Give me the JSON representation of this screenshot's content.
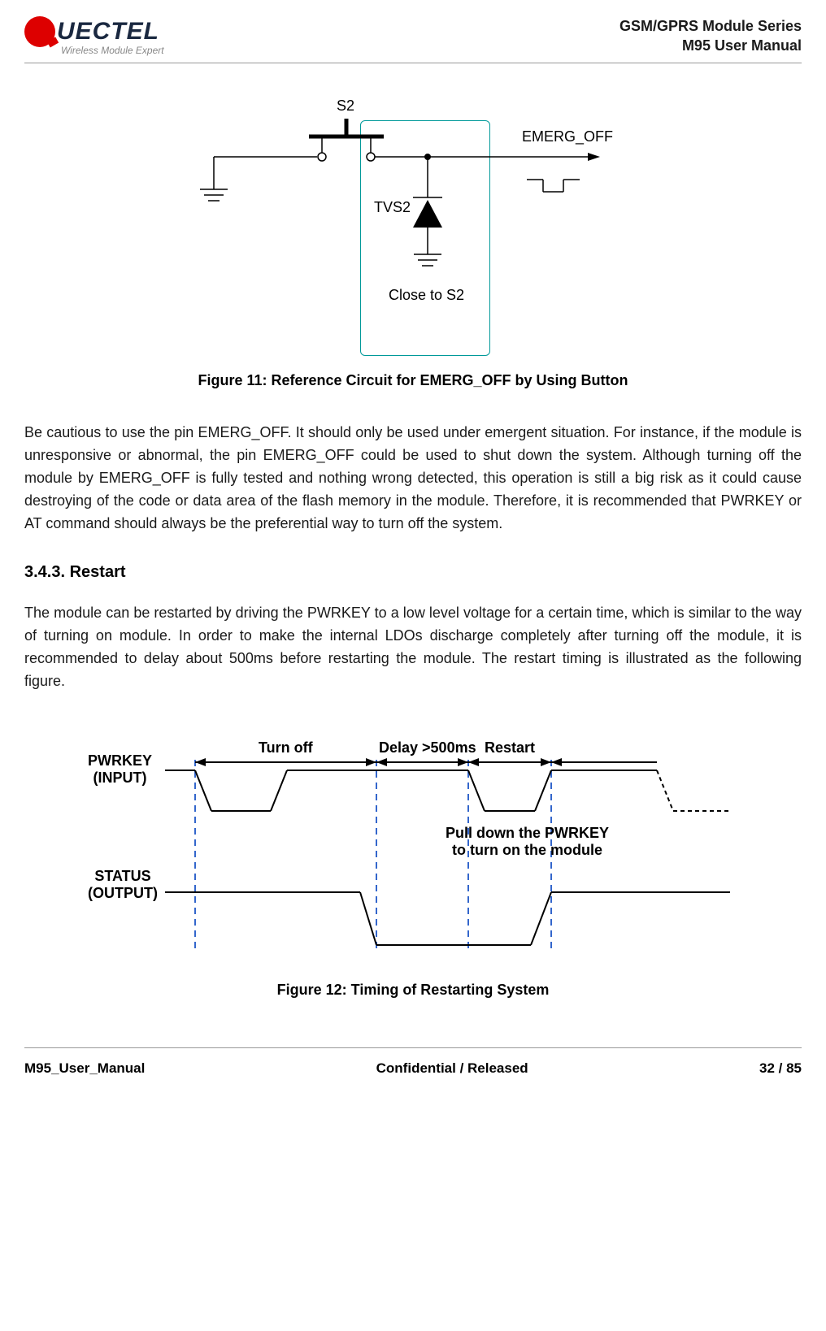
{
  "header": {
    "logo_text": "UECTEL",
    "logo_subtitle": "Wireless Module Expert",
    "series": "GSM/GPRS Module Series",
    "manual": "M95 User Manual"
  },
  "circuit": {
    "s2_label": "S2",
    "emerg_label": "EMERG_OFF",
    "tvs2_label": "TVS2",
    "close_label": "Close to S2"
  },
  "captions": {
    "figure11": "Figure 11: Reference Circuit for EMERG_OFF by Using Button",
    "figure12": "Figure 12: Timing of Restarting System"
  },
  "paragraphs": {
    "caution": "Be cautious to use the pin EMERG_OFF. It should only be used under emergent situation. For instance, if the module is unresponsive or abnormal, the pin EMERG_OFF could be used to shut down the system. Although turning off the module by EMERG_OFF is fully tested and nothing wrong detected, this operation is still a big risk as it could cause destroying of the code or data area of the flash memory in the module. Therefore, it is recommended that PWRKEY or AT command should always be the preferential way to turn off the system.",
    "restart": "The module can be restarted by driving the PWRKEY to a low level voltage for a certain time, which is similar to the way of turning on module. In order to make the internal LDOs discharge completely after turning off the module, it is recommended to delay about 500ms before restarting the module. The restart timing is illustrated as the following figure."
  },
  "sections": {
    "restart_heading": "3.4.3.  Restart"
  },
  "timing": {
    "pwrkey": "PWRKEY\n(INPUT)",
    "status": "STATUS\n(OUTPUT)",
    "turnoff": "Turn off",
    "delay": "Delay >500ms",
    "restart_label": "Restart",
    "pulldown": "Pull down the PWRKEY\nto turn on the module"
  },
  "footer": {
    "left": "M95_User_Manual",
    "center": "Confidential / Released",
    "right": "32 / 85"
  }
}
